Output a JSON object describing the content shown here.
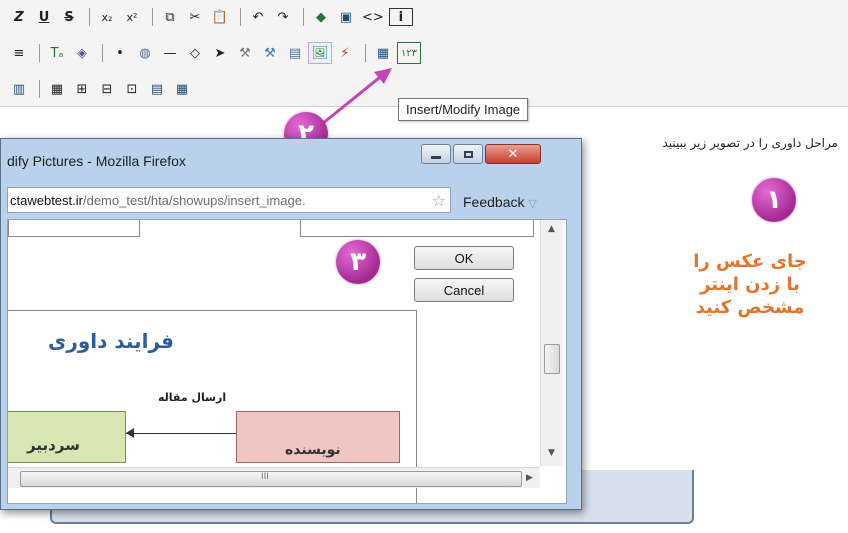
{
  "toolbar": {
    "row1": [
      "Z",
      "U",
      "S",
      "x₂",
      "x²",
      "⧉",
      "✂",
      "📋",
      "↶",
      "↷",
      "◆",
      "▣",
      "<>",
      "i"
    ],
    "row2": [
      "≡",
      "Tₐ",
      "◈",
      "•",
      "◍",
      "—",
      "◇",
      "➤",
      "⚒",
      "⚒",
      "▤",
      "🖼",
      "⚡",
      "▦",
      "١٢٣"
    ],
    "row3": [
      "▥",
      "▦",
      "⊞",
      "⊟",
      "⊡",
      "▤",
      "▦"
    ]
  },
  "tooltip": {
    "text": "Insert/Modify Image"
  },
  "content": {
    "instruction": "مراحل داوری را در تصویر زیر ببینید",
    "note_lines": [
      "جای عکس را",
      "با زدن اینتر",
      "مشخص کنید"
    ]
  },
  "markers": {
    "step1": "١",
    "step2": "٢",
    "step3": "٣"
  },
  "dialog": {
    "title": "dify Pictures - Mozilla Firefox",
    "url_domain": "ctawebtest.ir",
    "url_path": "/demo_test/hta/showups/insert_image.",
    "feedback": "Feedback",
    "ok": "OK",
    "cancel": "Cancel",
    "scroll_grip": "III"
  },
  "preview": {
    "title": "فرایند داوری",
    "arrow_label": "ارسال مقاله",
    "box_right": "نویسنده",
    "box_left": "سردبیر"
  },
  "colors": {
    "marker": "#b0359f",
    "note": "#e4732b",
    "arrow": "#c145b5"
  }
}
